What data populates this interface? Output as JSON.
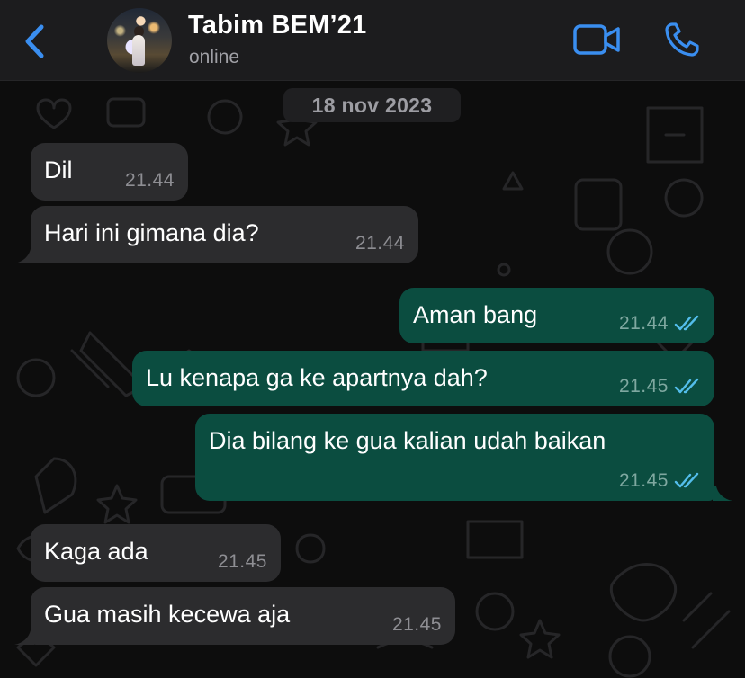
{
  "header": {
    "contact_name": "Tabim BEM’21",
    "status": "online"
  },
  "date_separator": "18 nov 2023",
  "messages": [
    {
      "direction": "in",
      "text": "Dil",
      "time": "21.44"
    },
    {
      "direction": "in",
      "text": "Hari ini gimana dia?",
      "time": "21.44"
    },
    {
      "direction": "out",
      "text": "Aman bang",
      "time": "21.44",
      "status": "read"
    },
    {
      "direction": "out",
      "text": "Lu kenapa ga ke apartnya dah?",
      "time": "21.45",
      "status": "read"
    },
    {
      "direction": "out",
      "text": "Dia bilang ke gua kalian udah baikan",
      "time": "21.45",
      "status": "read"
    },
    {
      "direction": "in",
      "text": "Kaga ada",
      "time": "21.45"
    },
    {
      "direction": "in",
      "text": "Gua masih kecewa aja",
      "time": "21.45"
    }
  ],
  "icons": {
    "back": "chevron-left-icon",
    "video": "video-camera-icon",
    "call": "phone-icon",
    "read_receipt": "double-check-icon"
  },
  "colors": {
    "accent": "#3a8ef0",
    "outgoing_bubble": "#0b4d40",
    "incoming_bubble": "#2c2c2e",
    "read_tick": "#53bdeb",
    "header_bg": "#1c1c1e",
    "chat_bg": "#0d0d0d"
  }
}
